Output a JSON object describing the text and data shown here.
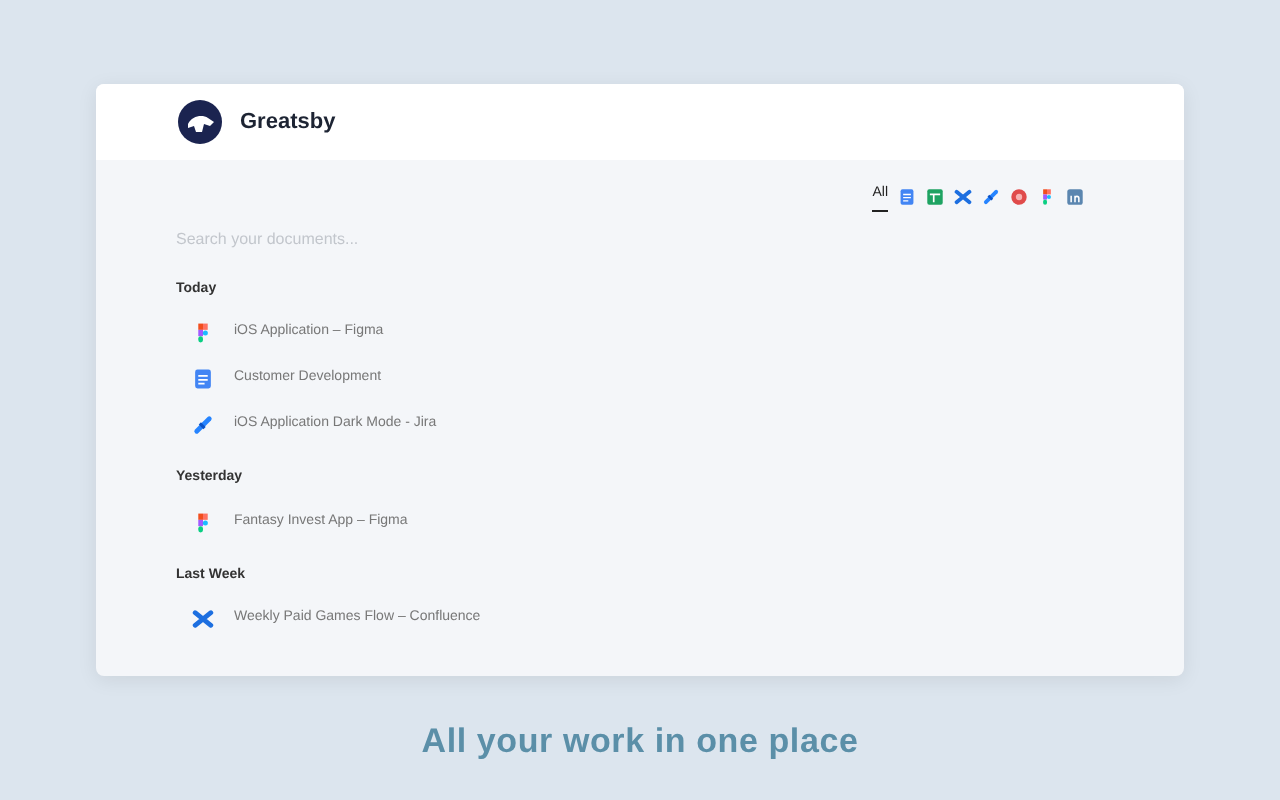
{
  "app": {
    "name": "Greatsby"
  },
  "filters": [
    {
      "kind": "all",
      "label": "All",
      "selected": true
    },
    {
      "kind": "docs",
      "selected": false
    },
    {
      "kind": "sheets",
      "selected": false
    },
    {
      "kind": "confluence",
      "selected": false
    },
    {
      "kind": "jira",
      "selected": false
    },
    {
      "kind": "badge",
      "selected": false
    },
    {
      "kind": "figma",
      "selected": false
    },
    {
      "kind": "linkedin",
      "selected": false
    }
  ],
  "search": {
    "placeholder": "Search your documents..."
  },
  "groups": [
    {
      "title": "Today",
      "items": [
        {
          "kind": "figma",
          "title": "iOS Application – Figma"
        },
        {
          "kind": "docs",
          "title": "Customer Development"
        },
        {
          "kind": "jira",
          "title": "iOS Application Dark Mode - Jira"
        }
      ]
    },
    {
      "title": "Yesterday",
      "items": [
        {
          "kind": "figma",
          "title": "Fantasy Invest App – Figma"
        }
      ]
    },
    {
      "title": "Last Week",
      "items": [
        {
          "kind": "confluence",
          "title": "Weekly Paid Games Flow – Confluence"
        }
      ]
    }
  ],
  "tagline": "All your work in one place"
}
